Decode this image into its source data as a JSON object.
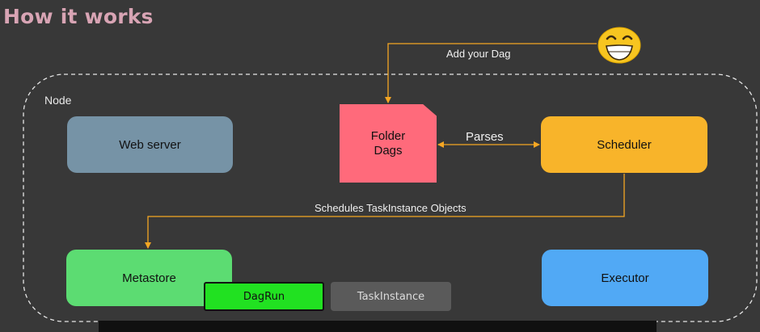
{
  "title": "How it works",
  "node_label": "Node",
  "components": {
    "web_server": "Web server",
    "folder_line1": "Folder",
    "folder_line2": "Dags",
    "scheduler": "Scheduler",
    "metastore": "Metastore",
    "executor": "Executor"
  },
  "edges": {
    "add_dag": "Add your Dag",
    "parses": "Parses",
    "schedules": "Schedules TaskInstance Objects"
  },
  "tabs": {
    "dagrun": "DagRun",
    "taskinstance": "TaskInstance"
  },
  "colors": {
    "title": "#d8a4b4",
    "web_server": "#7693a6",
    "folder": "#ff6a7b",
    "scheduler": "#f8b42a",
    "metastore": "#5cdc72",
    "executor": "#51a9f5",
    "arrow": "#f5a623",
    "dagrun_tab": "#21e121"
  },
  "icons": {
    "emoji": "grinning-face-icon"
  }
}
